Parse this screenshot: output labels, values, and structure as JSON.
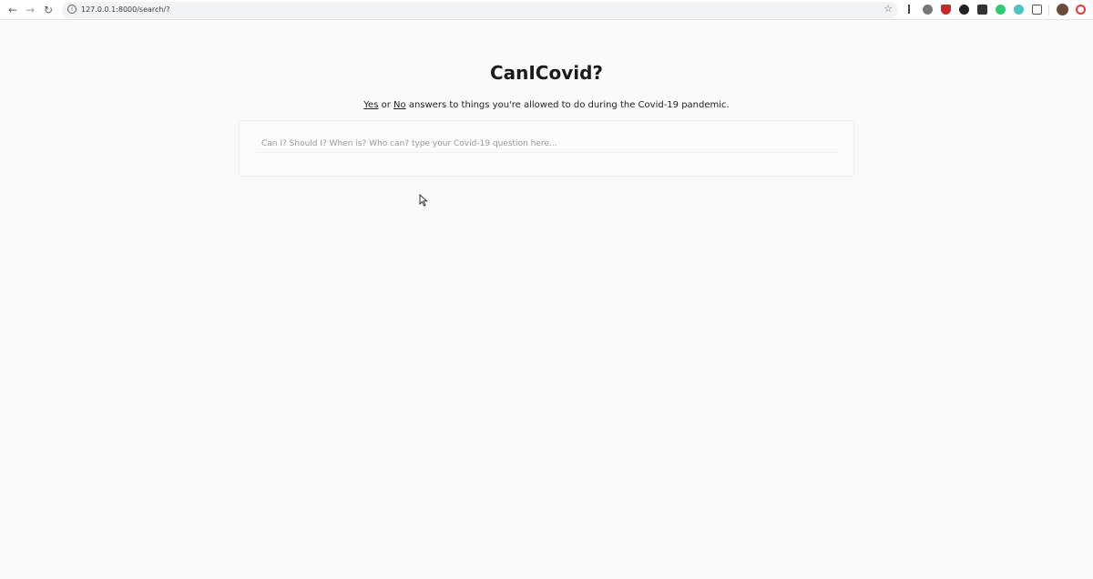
{
  "browser": {
    "url": "127.0.0.1:8000/search/?",
    "back_icon": "arrow-left-icon",
    "forward_icon": "arrow-right-icon",
    "reload_icon": "reload-icon",
    "info_icon": "info-icon",
    "bookmark_icon": "star-icon",
    "extensions": [
      {
        "name": "profile-extension-icon",
        "color": "#555555"
      },
      {
        "name": "shield-extension-icon",
        "color": "#c62828"
      },
      {
        "name": "circle-extension-icon",
        "color": "#222222"
      },
      {
        "name": "square-extension-icon",
        "color": "#333333"
      },
      {
        "name": "green-extension-icon",
        "color": "#2ecc71"
      },
      {
        "name": "teal-extension-icon",
        "color": "#4fc3c3"
      },
      {
        "name": "window-extension-icon",
        "color": "#555555"
      },
      {
        "name": "avatar-icon",
        "color": "#6b4a3a"
      },
      {
        "name": "opera-extension-icon",
        "color": "#e53935"
      }
    ]
  },
  "page": {
    "title": "CanICovid?",
    "subtitle": {
      "yes": "Yes",
      "or": " or ",
      "no": "No",
      "rest": " answers to things you're allowed to do during the Covid-19 pandemic."
    },
    "search": {
      "placeholder": "Can I? Should I? When is? Who can? type your Covid-19 question here...",
      "value": ""
    }
  },
  "colors": {
    "background": "#fafafa",
    "text": "#1a1a1a"
  }
}
